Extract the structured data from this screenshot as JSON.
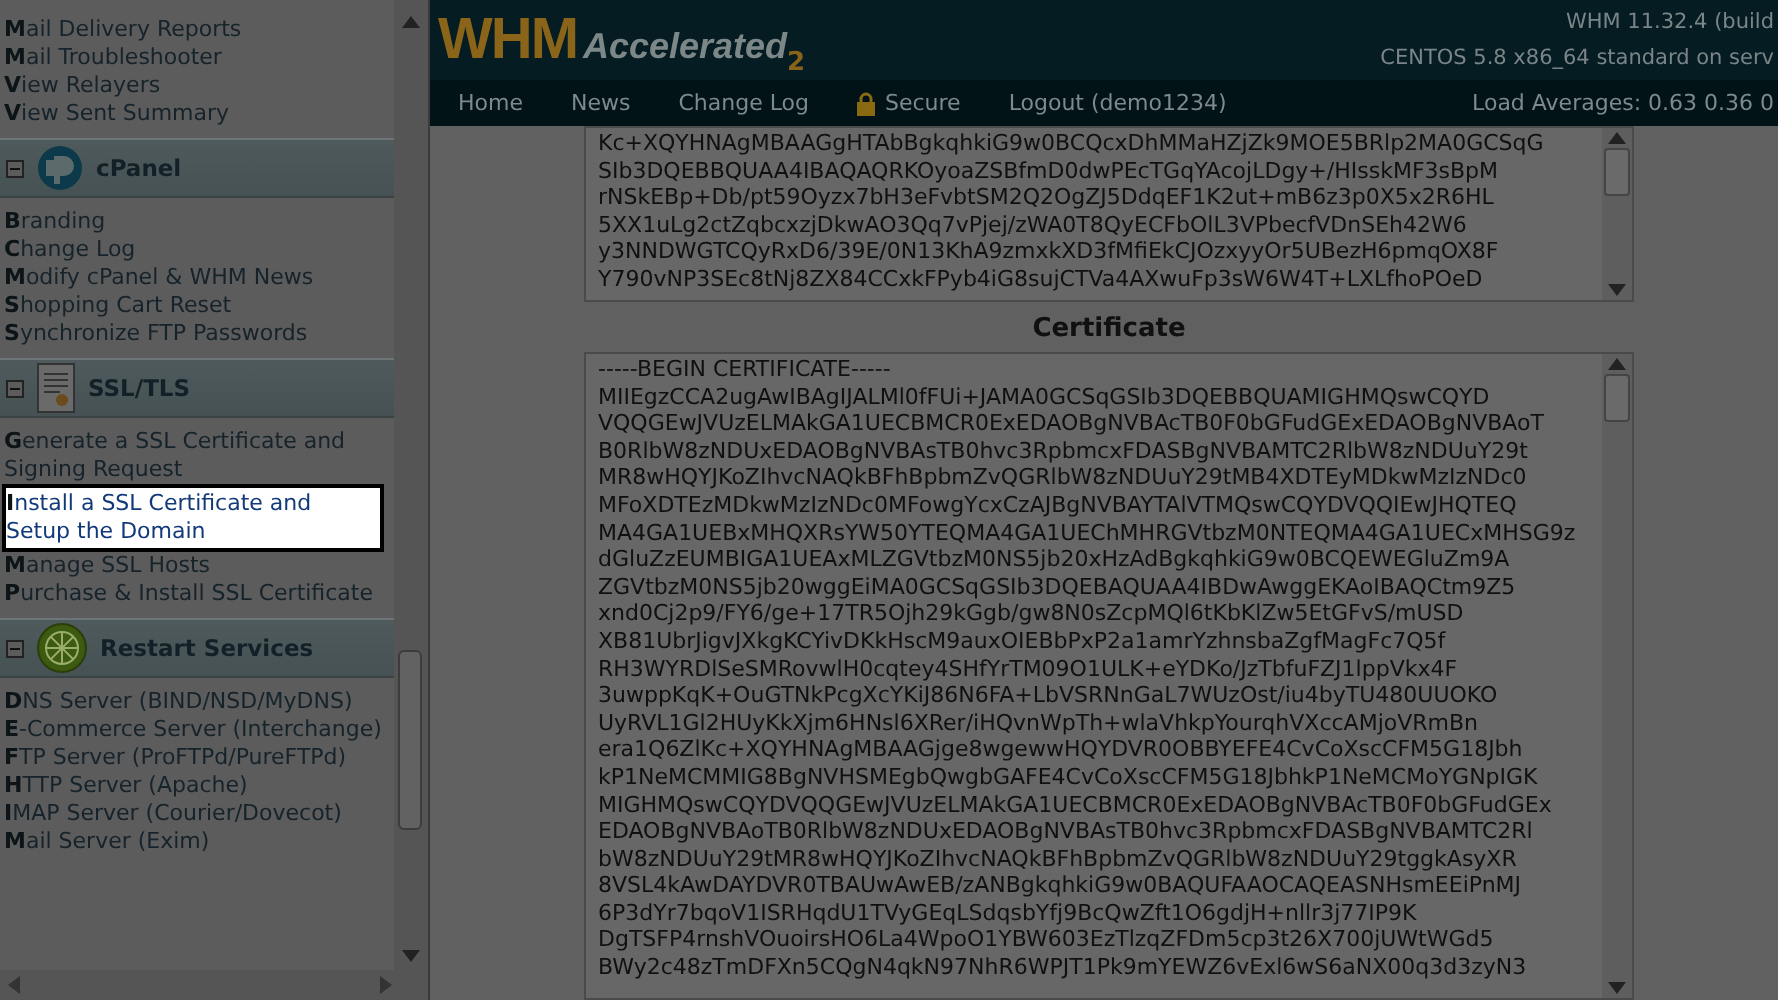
{
  "sidebar": {
    "sections": [
      {
        "kind": "plain",
        "items": [
          {
            "label": "Mail Delivery Reports",
            "selected": false
          },
          {
            "label": "Mail Troubleshooter",
            "selected": false
          },
          {
            "label": "View Relayers",
            "selected": false
          },
          {
            "label": "View Sent Summary",
            "selected": false
          }
        ]
      },
      {
        "kind": "cpanel",
        "title": "cPanel",
        "expanded": true,
        "items": [
          {
            "label": "Branding",
            "selected": false
          },
          {
            "label": "Change Log",
            "selected": false
          },
          {
            "label": "Modify cPanel & WHM News",
            "selected": false
          },
          {
            "label": "Shopping Cart Reset",
            "selected": false
          },
          {
            "label": "Synchronize FTP Passwords",
            "selected": false
          }
        ]
      },
      {
        "kind": "certificate",
        "title": "SSL/TLS",
        "expanded": true,
        "items": [
          {
            "label": "Generate a SSL Certificate and Signing Request",
            "selected": false
          },
          {
            "label": "Install a SSL Certificate and Setup the Domain",
            "selected": true
          },
          {
            "label": "Manage SSL Hosts",
            "selected": false
          },
          {
            "label": "Purchase & Install SSL Certificate",
            "selected": false
          }
        ]
      },
      {
        "kind": "restart",
        "title": "Restart Services",
        "expanded": true,
        "items": [
          {
            "label": "DNS Server (BIND/NSD/MyDNS)",
            "selected": false
          },
          {
            "label": "E-Commerce Server (Interchange)",
            "selected": false
          },
          {
            "label": "FTP Server (ProFTPd/PureFTPd)",
            "selected": false
          },
          {
            "label": "HTTP Server (Apache)",
            "selected": false
          },
          {
            "label": "IMAP Server (Courier/Dovecot)",
            "selected": false
          },
          {
            "label": "Mail Server (Exim)",
            "selected": false
          }
        ]
      }
    ]
  },
  "header": {
    "logo": "WHM",
    "logo_sub": "Accelerated",
    "logo_version": "2",
    "version": "WHM 11.32.4 (build",
    "os": "CENTOS 5.8 x86_64 standard on serv"
  },
  "nav": {
    "items": [
      {
        "label": "Home",
        "kind": "text"
      },
      {
        "label": "News",
        "kind": "text"
      },
      {
        "label": "Change Log",
        "kind": "text"
      },
      {
        "label": "Secure",
        "kind": "lock"
      },
      {
        "label": "Logout (demo1234)",
        "kind": "text"
      }
    ],
    "load": "Load Averages: 0.63 0.36 0"
  },
  "key_box": {
    "lines": [
      "Kc+XQYHNAgMBAAGgHTAbBgkqhkiG9w0BCQcxDhMMaHZjZk9MOE5BRlp2MA0GCSqG",
      "SIb3DQEBBQUAA4IBAQAQRKOyoaZSBfmD0dwPEcTGqYAcojLDgy+/HIsskMF3sBpM",
      "rNSkEBp+Db/pt59Oyzx7bH3eFvbtSM2Q2OgZJ5DdqEF1K2ut+mB6z3p0X5x2R6HL",
      "5XX1uLg2ctZqbcxzjDkwAO3Qq7vPjej/zWA0T8QyECFbOlL3VPbecfVDnSEh42W6",
      "y3NNDWGTCQyRxD6/39E/0N13KhA9zmxkXD3fMfiEkCJOzxyyOr5UBezH6pmqOX8F",
      "Y790vNP3SEc8tNj8ZX84CCxkFPyb4iG8sujCTVa4AXwuFp3sW6W4T+LXLfhoPOeD"
    ]
  },
  "certificate": {
    "label": "Certificate",
    "lines": [
      "-----BEGIN CERTIFICATE-----",
      "MIIEgzCCA2ugAwIBAgIJALMl0fFUi+JAMA0GCSqGSIb3DQEBBQUAMIGHMQswCQYD",
      "VQQGEwJVUzELMAkGA1UECBMCR0ExEDAOBgNVBAcTB0F0bGFudGExEDAOBgNVBAoT",
      "B0RlbW8zNDUxEDAOBgNVBAsTB0hvc3RpbmcxFDASBgNVBAMTC2RlbW8zNDUuY29t",
      "MR8wHQYJKoZIhvcNAQkBFhBpbmZvQGRlbW8zNDUuY29tMB4XDTEyMDkwMzIzNDc0",
      "MFoXDTEzMDkwMzIzNDc0MFowgYcxCzAJBgNVBAYTAlVTMQswCQYDVQQIEwJHQTEQ",
      "MA4GA1UEBxMHQXRsYW50YTEQMA4GA1UEChMHRGVtbzM0NTEQMA4GA1UECxMHSG9z",
      "dGluZzEUMBIGA1UEAxMLZGVtbzM0NS5jb20xHzAdBgkqhkiG9w0BCQEWEGluZm9A",
      "ZGVtbzM0NS5jb20wggEiMA0GCSqGSIb3DQEBAQUAA4IBDwAwggEKAoIBAQCtm9Z5",
      "xnd0Cj2p9/FY6/ge+17TR5Ojh29kGgb/gw8N0sZcpMQl6tKbKlZw5EtGFvS/mUSD",
      "XB81UbrJigvJXkgKCYivDKkHscM9auxOIEBbPxP2a1amrYzhnsbaZgfMagFc7Q5f",
      "RH3WYRDlSeSMRovwlH0cqtey4SHfYrTM09O1ULK+eYDKo/JzTbfuFZJ1lppVkx4F",
      "3uwppKqK+OuGTNkPcgXcYKiJ86N6FA+LbVSRNnGaL7WUzOst/iu4byTU480UUOKO",
      "UyRVL1Gl2HUyKkXjm6HNsl6XRer/iHQvnWpTh+wlaVhkpYourqhVXccAMjoVRmBn",
      "era1Q6ZlKc+XQYHNAgMBAAGjge8wgewwHQYDVR0OBBYEFE4CvCoXscCFM5G18Jbh",
      "kP1NeMCMMIG8BgNVHSMEgbQwgbGAFE4CvCoXscCFM5G18JbhkP1NeMCMoYGNpIGK",
      "MIGHMQswCQYDVQQGEwJVUzELMAkGA1UECBMCR0ExEDAOBgNVBAcTB0F0bGFudGEx",
      "EDAOBgNVBAoTB0RlbW8zNDUxEDAOBgNVBAsTB0hvc3RpbmcxFDASBgNVBAMTC2Rl",
      "bW8zNDUuY29tMR8wHQYJKoZIhvcNAQkBFhBpbmZvQGRlbW8zNDUuY29tggkAsyXR",
      "8VSL4kAwDAYDVR0TBAUwAwEB/zANBgkqhkiG9w0BAQUFAAOCAQEASNHsmEEiPnMJ",
      "6P3dYr7bqoV1ISRHqdU1TVyGEqLSdqsbYfj9BcQwZft1O6gdjH+nllr3j77IP9K",
      "DgTSFP4rnshVOuoirsHO6La4WpoO1YBW603EzTlzqZFDm5cp3t26X700jUWtWGd5",
      "BWy2c48zTmDFXn5CQgN4qkN97NhR6WPJT1Pk9mYEWZ6vExl6wS6aNX00q3d3zyN3"
    ]
  }
}
